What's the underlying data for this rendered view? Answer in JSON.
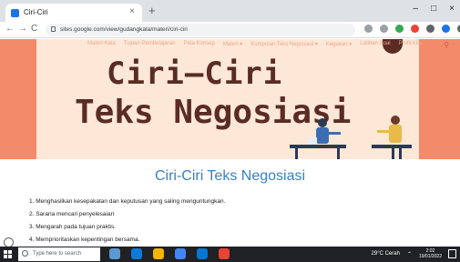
{
  "browser": {
    "tab_title": "Ciri-Ciri",
    "tab_close": "×",
    "new_tab": "+",
    "controls": {
      "minimize": "–",
      "maximize": "□",
      "close": "×"
    },
    "nav": {
      "back": "←",
      "forward": "→",
      "reload": "C"
    },
    "url": "sites.google.com/view/gudangkata/materi/ciri-ciri"
  },
  "hero": {
    "menu_items": [
      "Materi Kata",
      "Tujuan Pembelajaran",
      "Peta Konsep",
      "Materi ▾",
      "Kumpulan Teks Negosiasi ▾",
      "Kegiatan ▾",
      "Latihan Soal",
      "Profil Kita"
    ],
    "title_line1": "Ciri–Ciri",
    "title_line2": "Teks Negosiasi"
  },
  "content": {
    "section_title": "Ciri-Ciri Teks Negosiasi",
    "items": [
      "1. Menghasilkan kesepakatan dan keputusan yang saling menguntungkan.",
      "2. Sarana mencari penyelesaian",
      "3. Mengarah pada tujuan praktis.",
      "4. Memprioritaskan kepentingan bersama."
    ]
  },
  "taskbar": {
    "search_placeholder": "Type here to search",
    "weather": "29°C  Cerah",
    "time": "2:02",
    "date": "19/01/2022"
  },
  "colors": {
    "hero_outer": "#f38a6a",
    "hero_inner": "#fde8d7",
    "title_brown": "#5a2c22",
    "section_blue": "#3a7fc2"
  }
}
